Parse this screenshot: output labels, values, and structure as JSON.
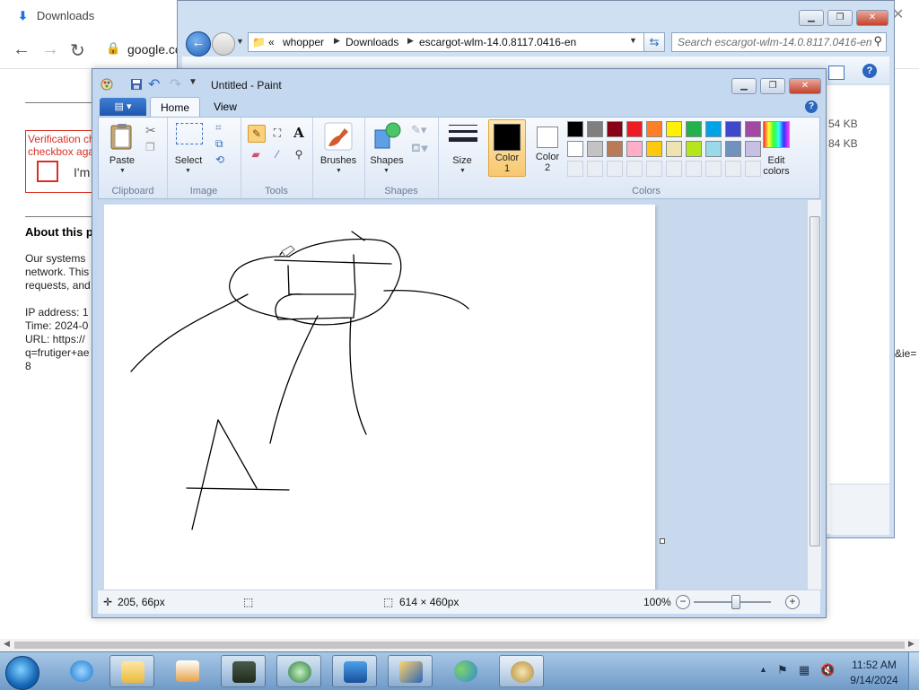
{
  "chrome": {
    "tab_title": "Downloads",
    "url": "google.co",
    "page": {
      "verification_text": "Verification ch\ncheckbox aga",
      "checkbox_label": "I'm",
      "about_heading": "About this p",
      "para_lines": [
        "Our systems",
        "network. This",
        "requests, and"
      ],
      "ip_line": "IP address: 1",
      "time_line": "Time: 2024-0",
      "url_line": "URL: https://",
      "q_line": "q=frutiger+ae",
      "num_line": "8",
      "ie_text": "&ie="
    }
  },
  "explorer": {
    "breadcrumb": [
      "«",
      "whopper",
      "Downloads",
      "escargot-wlm-14.0.8117.0416-en"
    ],
    "search_placeholder": "Search escargot-wlm-14.0.8117.0416-en",
    "sizes": [
      "54 KB",
      "84 KB"
    ]
  },
  "paint": {
    "title": "Untitled - Paint",
    "tabs": {
      "home": "Home",
      "view": "View"
    },
    "groups": {
      "clipboard": "Clipboard",
      "image": "Image",
      "tools": "Tools",
      "shapes": "Shapes",
      "colors": "Colors"
    },
    "buttons": {
      "paste": "Paste",
      "select": "Select",
      "brushes": "Brushes",
      "shapes": "Shapes",
      "size": "Size",
      "color1": "Color\n1",
      "color2": "Color\n2",
      "edit_colors": "Edit\ncolors"
    },
    "palette_row1": [
      "#000000",
      "#7f7f7f",
      "#880015",
      "#ed1c24",
      "#ff7f27",
      "#fff200",
      "#22b14c",
      "#00a2e8",
      "#3f48cc",
      "#a349a4"
    ],
    "palette_row2": [
      "#ffffff",
      "#c3c3c3",
      "#b97a57",
      "#ffaec9",
      "#ffc90e",
      "#efe4b0",
      "#b5e61d",
      "#99d9ea",
      "#7092be",
      "#c8bfe7"
    ],
    "color1_value": "#000000",
    "color2_value": "#ffffff",
    "status": {
      "cursor_pos": "205, 66px",
      "canvas_size": "614 × 460px",
      "zoom": "100%"
    }
  },
  "taskbar": {
    "time": "11:52 AM",
    "date": "9/14/2024"
  }
}
